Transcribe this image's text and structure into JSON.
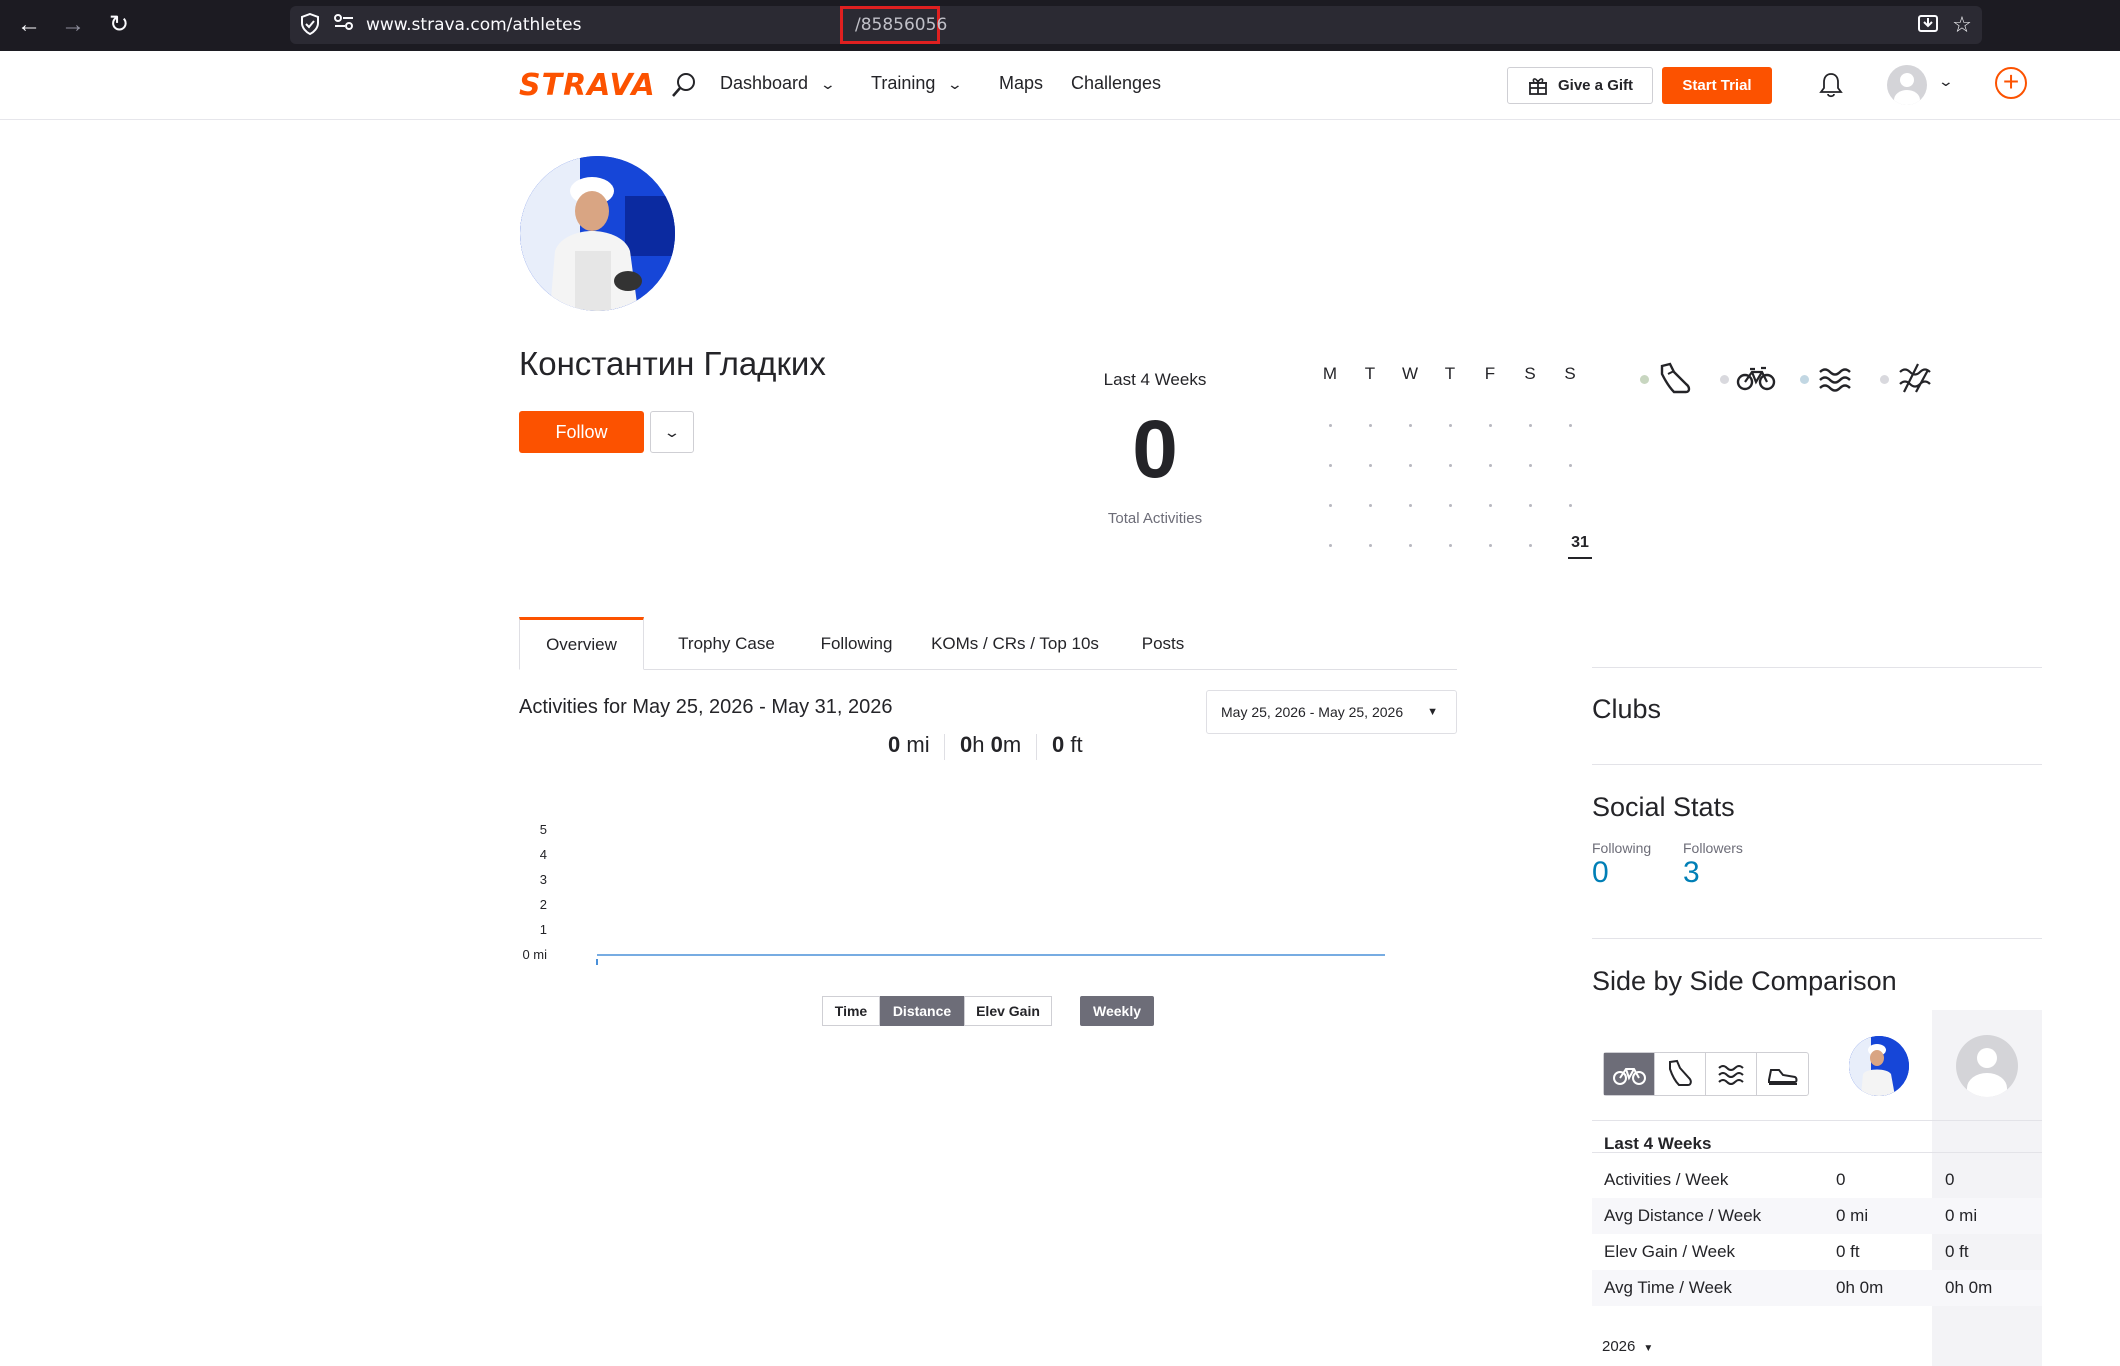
{
  "browser": {
    "url_prefix": "www.strava.com/athletes",
    "url_id": "/85856056"
  },
  "nav": {
    "logo": "STRAVA",
    "dashboard": "Dashboard",
    "training": "Training",
    "maps": "Maps",
    "challenges": "Challenges",
    "give_gift": "Give a Gift",
    "start_trial": "Start Trial"
  },
  "profile": {
    "name": "Константин Гладких",
    "follow": "Follow"
  },
  "last4weeks": {
    "title": "Last 4 Weeks",
    "total": "0",
    "subtitle": "Total Activities"
  },
  "calendar": {
    "days": [
      "M",
      "T",
      "W",
      "T",
      "F",
      "S",
      "S"
    ],
    "today": "31"
  },
  "tabs": [
    "Overview",
    "Trophy Case",
    "Following",
    "KOMs / CRs / Top 10s",
    "Posts"
  ],
  "activities": {
    "title": "Activities for May 25, 2026 - May 31, 2026",
    "date_range": "May 25, 2026 - May 25, 2026",
    "distance_val": "0",
    "distance_unit": "mi",
    "time_h": "0",
    "time_m": "0",
    "elev_val": "0",
    "elev_unit": "ft"
  },
  "chart_data": {
    "type": "line",
    "y_ticks": [
      "5",
      "4",
      "3",
      "2",
      "1",
      "0 mi"
    ],
    "ylim": [
      0,
      5
    ],
    "values": [
      0
    ]
  },
  "chart_controls": {
    "time": "Time",
    "distance": "Distance",
    "elev_gain": "Elev Gain",
    "weekly": "Weekly"
  },
  "sidebar": {
    "clubs": "Clubs",
    "social_stats": "Social Stats",
    "following_label": "Following",
    "following_val": "0",
    "followers_label": "Followers",
    "followers_val": "3",
    "comparison": "Side by Side Comparison",
    "cmp_period": "Last 4 Weeks",
    "rows": [
      {
        "label": "Activities / Week",
        "a": "0",
        "b": "0"
      },
      {
        "label": "Avg Distance / Week",
        "a": "0 mi",
        "b": "0 mi"
      },
      {
        "label": "Elev Gain / Week",
        "a": "0 ft",
        "b": "0 ft"
      },
      {
        "label": "Avg Time / Week",
        "a": "0h 0m",
        "b": "0h 0m"
      }
    ],
    "year": "2026"
  },
  "colors": {
    "brand": "#fc5200",
    "link": "#007fb6",
    "line": "#4a90d9"
  }
}
